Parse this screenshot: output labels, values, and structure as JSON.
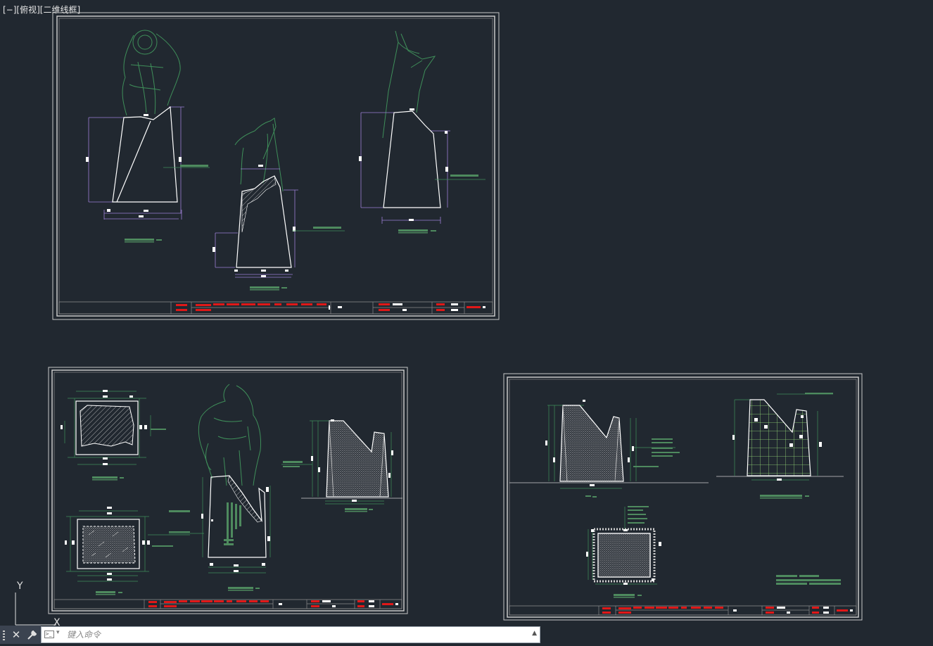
{
  "viewport": {
    "label": "[−][俯视][二维线框]"
  },
  "ucs": {
    "y_label": "Y",
    "x_label": "X"
  },
  "command_line": {
    "placeholder": "键入命令",
    "close_icon": "close-icon",
    "settings_icon": "wrench-icon",
    "prompt_icon": "command-prompt-icon",
    "history_icon": "triangle-up-icon"
  },
  "colors": {
    "background": "#212830",
    "sheet_border": "#c8c8c8",
    "outline": "#ffffff",
    "dimension": "#9b7fd4",
    "figure": "#3f8f5a",
    "annotation": "#4e8a5e",
    "title_block_red": "#e01818"
  }
}
